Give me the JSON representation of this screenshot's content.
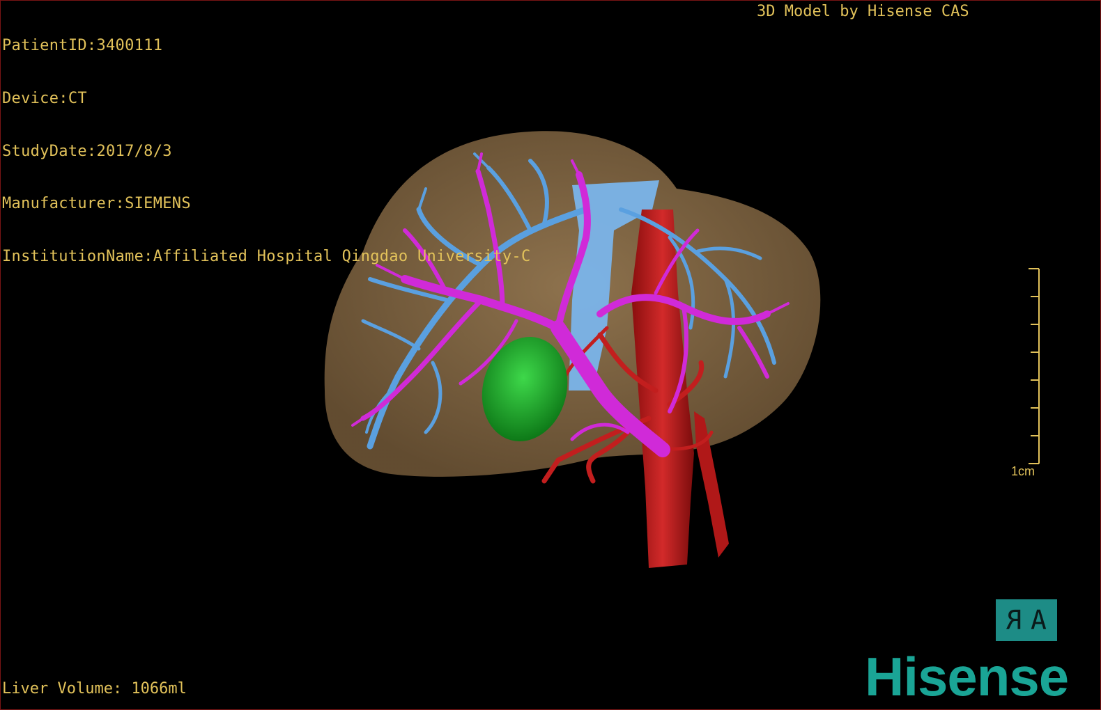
{
  "patient_info": {
    "patient_id": "PatientID:3400111",
    "device": "Device:CT",
    "study_date": "StudyDate:2017/8/3",
    "manufacturer": "Manufacturer:SIEMENS",
    "institution": "InstitutionName:Affiliated Hospital Qingdao University-C"
  },
  "credit": "3D Model by Hisense CAS",
  "liver_volume": "Liver Volume: 1066ml",
  "scale_bar": {
    "label": "1cm"
  },
  "orientation_button": {
    "left_glyph": "R",
    "right_glyph": "A"
  },
  "brand": "Hisense",
  "colors": {
    "text": "#e2c25a",
    "liver": "#8a6e4a",
    "portal_vein": "#d02ad8",
    "hepatic_vein": "#5aa0e0",
    "artery": "#b81a1a",
    "gallbladder": "#1fae2a",
    "brand": "#1aa596"
  }
}
